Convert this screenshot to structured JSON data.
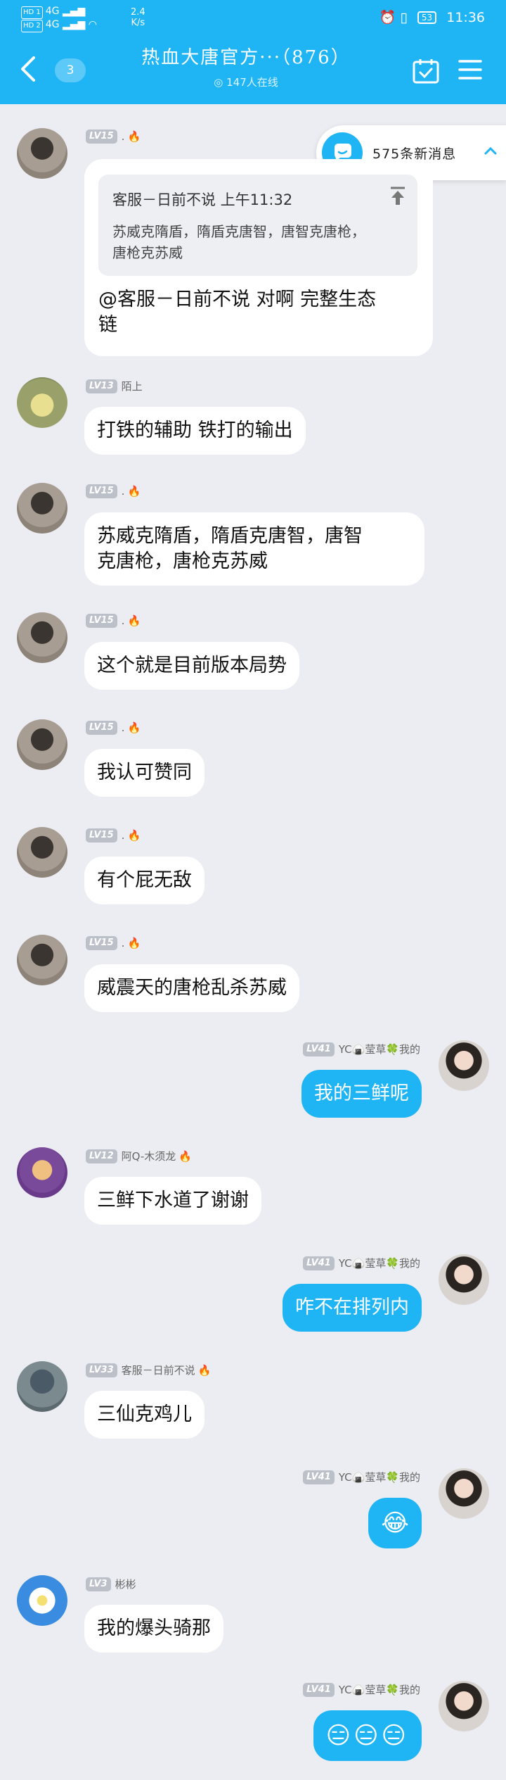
{
  "status_bar": {
    "hd1": "HD 1",
    "hd2": "HD 2",
    "net_left": "4G",
    "net_right": "4G",
    "speed_value": "2.4",
    "speed_unit": "K/s",
    "battery": "53",
    "time": "11:36"
  },
  "header": {
    "unread_count": "3",
    "title": "热血大唐官方···（876）",
    "online": "147人在线"
  },
  "new_messages": {
    "label": "575条新消息"
  },
  "messages": [
    {
      "level": "LV15",
      "nick": ".",
      "fire": true,
      "quote_head": "客服－日前不说 上午11:32",
      "quote_body": "苏威克隋盾，隋盾克唐智，唐智克唐枪，唐枪克苏威",
      "text_line1": "@客服－日前不说 对啊 完整生态",
      "text_line2": "链"
    },
    {
      "level": "LV13",
      "nick": "陌上",
      "text": "打铁的辅助 铁打的输出"
    },
    {
      "level": "LV15",
      "nick": ".",
      "fire": true,
      "text_line1": "苏威克隋盾，隋盾克唐智，唐智",
      "text_line2": "克唐枪，唐枪克苏威"
    },
    {
      "level": "LV15",
      "nick": ".",
      "fire": true,
      "text": "这个就是目前版本局势"
    },
    {
      "level": "LV15",
      "nick": ".",
      "fire": true,
      "text": "我认可赞同"
    },
    {
      "level": "LV15",
      "nick": ".",
      "fire": true,
      "text": "有个屁无敌"
    },
    {
      "level": "LV15",
      "nick": ".",
      "fire": true,
      "text": "威震天的唐枪乱杀苏威"
    },
    {
      "level": "LV41",
      "nick": "YC🍙莹草🍀我的",
      "text": "我的三鲜呢"
    },
    {
      "level": "LV12",
      "nick": "阿Q-木须龙",
      "fire": true,
      "text": "三鲜下水道了谢谢"
    },
    {
      "level": "LV41",
      "nick": "YC🍙莹草🍀我的",
      "text": "咋不在排列内"
    },
    {
      "level": "LV33",
      "nick": "客服－日前不说",
      "fire": true,
      "text": "三仙克鸡儿"
    },
    {
      "level": "LV41",
      "nick": "YC🍙莹草🍀我的",
      "text": "😂"
    },
    {
      "level": "LV3",
      "nick": "彬彬",
      "text": "我的爆头骑那"
    },
    {
      "level": "LV41",
      "nick": "YC🍙莹草🍀我的",
      "text": "😑😑😑"
    }
  ],
  "colors": {
    "accent": "#1fb5f5",
    "background": "#ecedf2",
    "bubble_other": "#ffffff",
    "level_badge": "#bcc0c8"
  }
}
